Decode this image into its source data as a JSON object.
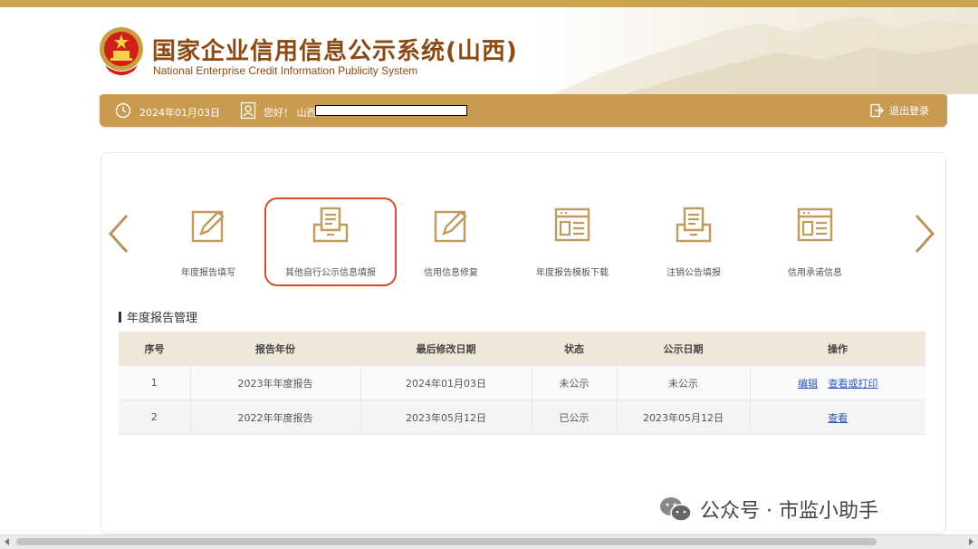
{
  "site": {
    "title": "国家企业信用信息公示系统(山西)",
    "subtitle": "National Enterprise Credit Information Publicity System",
    "emblem_icon": "national-emblem-icon"
  },
  "topbar": {
    "date": "2024年01月03日",
    "greeting": "您好！ 山西",
    "logout_label": "退出登录"
  },
  "menu": {
    "items": [
      {
        "label": "年度报告填写",
        "icon": "edit-document-icon"
      },
      {
        "label": "其他自行公示信息填报",
        "icon": "inbox-document-icon"
      },
      {
        "label": "信用信息修复",
        "icon": "edit-document-icon"
      },
      {
        "label": "年度报告模板下载",
        "icon": "template-window-icon"
      },
      {
        "label": "注销公告填报",
        "icon": "inbox-document-icon"
      },
      {
        "label": "信用承诺信息",
        "icon": "template-window-icon"
      }
    ]
  },
  "annual_report": {
    "section_title": "年度报告管理",
    "columns": [
      "序号",
      "报告年份",
      "最后修改日期",
      "状态",
      "公示日期",
      "操作"
    ],
    "rows": [
      {
        "no": "1",
        "year": "2023年年度报告",
        "modified": "2024年01月03日",
        "status": "未公示",
        "publish_date": "未公示",
        "actions": [
          "编辑",
          "查看或打印"
        ]
      },
      {
        "no": "2",
        "year": "2022年年度报告",
        "modified": "2023年05月12日",
        "status": "已公示",
        "publish_date": "2023年05月12日",
        "actions": [
          "查看"
        ]
      }
    ]
  },
  "watermark": {
    "text": "公众号 · 市监小助手"
  },
  "colors": {
    "accent_bar": "#c89b51",
    "title": "#8b4a13",
    "highlight": "#d44a2a",
    "link": "#2b59b8"
  }
}
